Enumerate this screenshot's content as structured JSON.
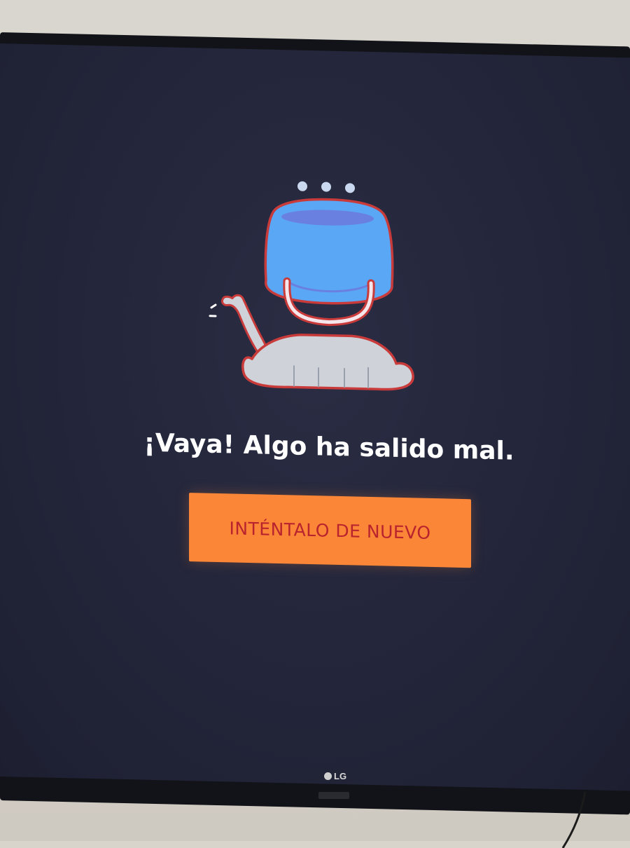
{
  "error_screen": {
    "headline": "¡Vaya! Algo ha salido mal.",
    "retry_button_label": "INTÉNTALO DE NUEVO",
    "illustration": "cat-with-bucket-on-head-icon"
  },
  "device": {
    "brand_logo": "LG"
  },
  "colors": {
    "screen_background": "#23253a",
    "button_background": "#fb8637",
    "button_text": "#b8232e",
    "headline_text": "#ffffff",
    "bucket_blue": "#5aa7f5",
    "outline_red": "#c93b3b",
    "cat_gray": "#cfd2d8"
  }
}
